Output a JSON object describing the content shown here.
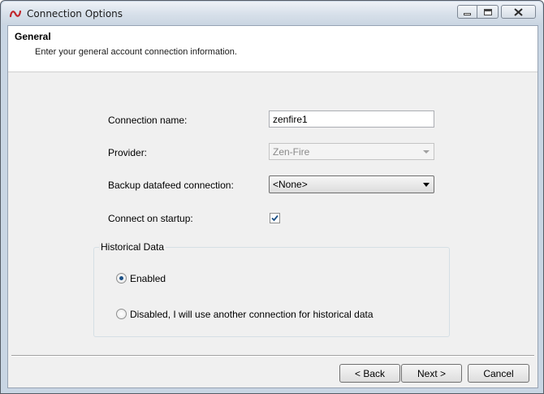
{
  "window": {
    "title": "Connection Options",
    "icon": "connection-logo-icon"
  },
  "header": {
    "title": "General",
    "subtitle": "Enter your general account connection information."
  },
  "form": {
    "connection_name_label": "Connection name:",
    "connection_name_value": "zenfire1",
    "provider_label": "Provider:",
    "provider_value": "Zen-Fire",
    "backup_label": "Backup datafeed connection:",
    "backup_value": "<None>",
    "startup_label": "Connect on startup:",
    "startup_checked": true
  },
  "historical": {
    "group_title": "Historical Data",
    "options": [
      {
        "label": "Enabled",
        "selected": true
      },
      {
        "label": "Disabled, I will use another connection for historical data",
        "selected": false
      }
    ]
  },
  "buttons": {
    "back": "< Back",
    "next": "Next >",
    "cancel": "Cancel"
  },
  "colors": {
    "accent": "#1a4f85",
    "logo": "#c0262b"
  }
}
